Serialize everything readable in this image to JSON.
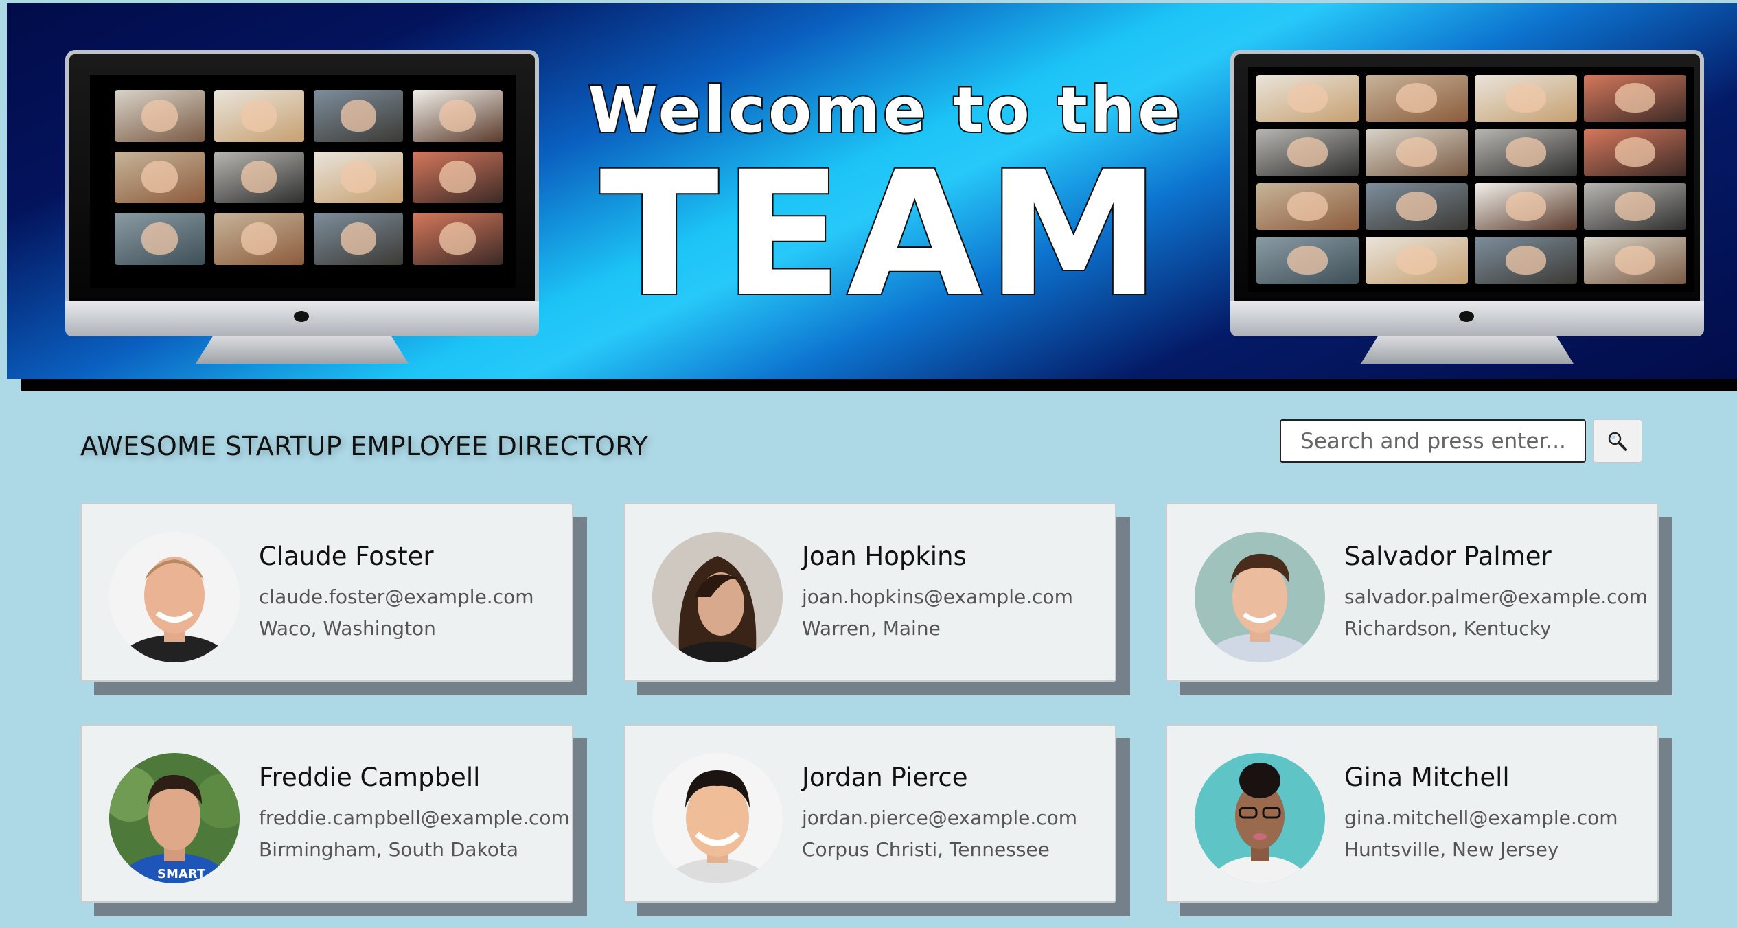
{
  "banner": {
    "line1": "Welcome to the",
    "line2": "TEAM"
  },
  "directory": {
    "title": "AWESOME STARTUP EMPLOYEE DIRECTORY"
  },
  "search": {
    "placeholder": "Search and press enter...",
    "button_icon": "search-icon"
  },
  "employees": [
    {
      "name": "Claude Foster",
      "email": "claude.foster@example.com",
      "location": "Waco, Washington"
    },
    {
      "name": "Joan Hopkins",
      "email": "joan.hopkins@example.com",
      "location": "Warren, Maine"
    },
    {
      "name": "Salvador Palmer",
      "email": "salvador.palmer@example.com",
      "location": "Richardson, Kentucky"
    },
    {
      "name": "Freddie Campbell",
      "email": "freddie.campbell@example.com",
      "location": "Birmingham, South Dakota"
    },
    {
      "name": "Jordan Pierce",
      "email": "jordan.pierce@example.com",
      "location": "Corpus Christi, Tennessee"
    },
    {
      "name": "Gina Mitchell",
      "email": "gina.mitchell@example.com",
      "location": "Huntsville, New Jersey"
    }
  ],
  "colors": {
    "page_background": "#add8e6",
    "card_background": "#eef1f2",
    "card_shadow": "#75818a",
    "banner_dark": "#020c4a",
    "banner_light": "#27c9f9"
  }
}
